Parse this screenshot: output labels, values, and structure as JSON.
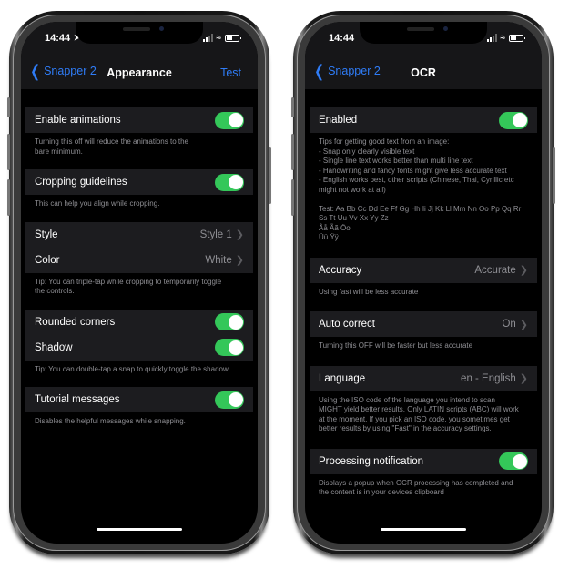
{
  "status_bar": {
    "time": "14:44"
  },
  "appearance": {
    "nav": {
      "back_label": "Snapper 2",
      "title": "Appearance",
      "action_label": "Test"
    },
    "sections": [
      {
        "rows": [
          {
            "label": "Enable animations",
            "type": "toggle",
            "on": true
          }
        ],
        "footer": "Turning this off will reduce the animations to the\nbare minimum."
      },
      {
        "rows": [
          {
            "label": "Cropping guidelines",
            "type": "toggle",
            "on": true
          }
        ],
        "footer": "This can help you align while cropping."
      },
      {
        "rows": [
          {
            "label": "Style",
            "type": "disclosure",
            "value": "Style 1"
          },
          {
            "label": "Color",
            "type": "disclosure",
            "value": "White"
          }
        ],
        "footer": "Tip: You can triple-tap while cropping to temporarily toggle\nthe controls."
      },
      {
        "rows": [
          {
            "label": "Rounded corners",
            "type": "toggle",
            "on": true
          },
          {
            "label": "Shadow",
            "type": "toggle",
            "on": true
          }
        ],
        "footer": "Tip: You can double-tap a snap to quickly toggle the shadow."
      },
      {
        "rows": [
          {
            "label": "Tutorial messages",
            "type": "toggle",
            "on": true
          }
        ],
        "footer": "Disables the helpful messages while snapping."
      }
    ]
  },
  "ocr": {
    "nav": {
      "back_label": "Snapper 2",
      "title": "OCR"
    },
    "sections": [
      {
        "rows": [
          {
            "label": "Enabled",
            "type": "toggle",
            "on": true
          }
        ],
        "footer": "Tips for getting good text from an image:\n- Snap only clearly visible text\n- Single line text works better than multi line text\n- Handwriting and fancy fonts might give less accurate text\n- English works best, other scripts (Chinese, Thai, Cyrillic etc\nmight not work at all)\n\nTest: Aa Bb Cc Dd Ee Ff Gg Hh Ii Jj Kk Ll Mm Nn Oo Pp Qq Rr\nSs Tt Uu Vv Xx Yy Zz\nÅå Ãã Öo\nÜü Ÿÿ"
      },
      {
        "rows": [
          {
            "label": "Accuracy",
            "type": "disclosure",
            "value": "Accurate"
          }
        ],
        "footer": "Using fast will be less accurate"
      },
      {
        "rows": [
          {
            "label": "Auto correct",
            "type": "disclosure",
            "value": "On"
          }
        ],
        "footer": "Turning this OFF will be faster but less accurate"
      },
      {
        "rows": [
          {
            "label": "Language",
            "type": "disclosure",
            "value": "en - English"
          }
        ],
        "footer": "Using the ISO code of the language you intend to scan\nMIGHT yield better results. Only LATIN scripts (ABC) will work\nat the moment. If you pick an ISO code, you sometimes get\nbetter results by using \"Fast\" in the accuracy settings."
      },
      {
        "rows": [
          {
            "label": "Processing notification",
            "type": "toggle",
            "on": true
          }
        ],
        "footer": "Displays a popup when OCR processing has completed and\nthe content is in your devices clipboard"
      }
    ]
  },
  "colors": {
    "accent": "#2f7cf6",
    "toggle_on": "#34c759",
    "row_bg": "#1c1c1f",
    "footer_text": "#8e8e93"
  }
}
